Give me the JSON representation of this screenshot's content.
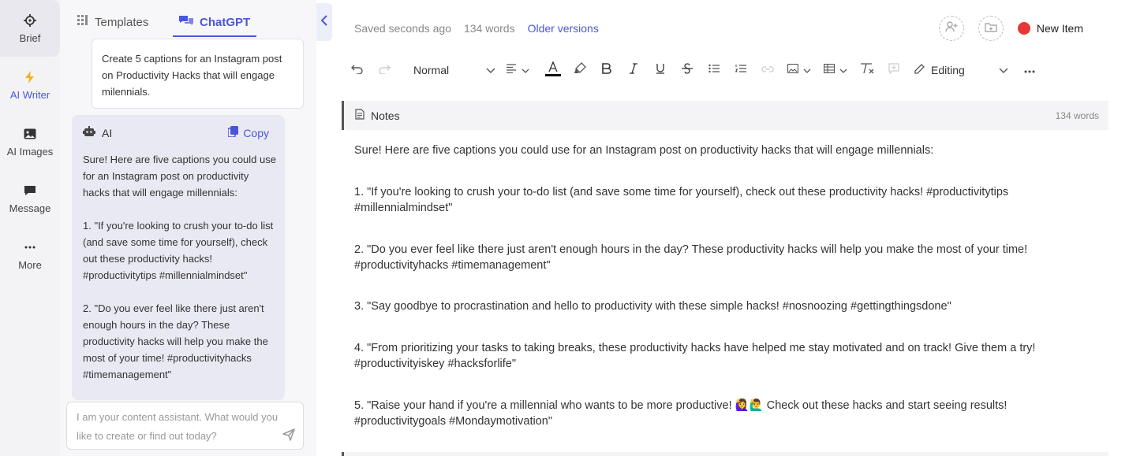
{
  "rail": {
    "items": [
      {
        "label": "Brief",
        "icon": "crosshair-icon"
      },
      {
        "label": "AI Writer",
        "icon": "lightning-icon"
      },
      {
        "label": "AI Images",
        "icon": "image-icon"
      },
      {
        "label": "Message",
        "icon": "chat-icon"
      },
      {
        "label": "More",
        "icon": "ellipsis-icon"
      }
    ]
  },
  "panel": {
    "tabs": [
      {
        "label": "Templates",
        "icon": "grid-icon"
      },
      {
        "label": "ChatGPT",
        "icon": "chat-bubbles-icon"
      }
    ],
    "prompt": "Create 5 captions for an Instagram post on Productivity Hacks that will engage milennials.",
    "ai": {
      "sender": "AI",
      "copy_label": "Copy",
      "paragraphs": [
        "Sure! Here are five captions you could use for an Instagram post on productivity hacks that will engage millennials:",
        "1. \"If you're looking to crush your to-do list (and save some time for yourself), check out these productivity hacks! #productivitytips #millennialmindset\"",
        "2. \"Do you ever feel like there just aren't enough hours in the day? These productivity hacks will help you make the most of your time! #productivityhacks #timemanagement\""
      ]
    },
    "input_placeholder": "I am your content assistant. What would you like to create or find out today?"
  },
  "editor": {
    "status": {
      "saved": "Saved seconds ago",
      "words": "134 words",
      "versions_link": "Older versions"
    },
    "new_item_label": "New Item",
    "toolbar": {
      "style_select": "Normal",
      "mode_select": "Editing"
    },
    "notes": {
      "title": "Notes",
      "count": "134 words"
    },
    "doc": {
      "paragraphs": [
        "Sure! Here are five captions you could use for an Instagram post on productivity hacks that will engage millennials:",
        "1. \"If you're looking to crush your to-do list (and save some time for yourself), check out these productivity hacks! #productivitytips #millennialmindset\"",
        "2. \"Do you ever feel like there just aren't enough hours in the day? These productivity hacks will help you make the most of your time! #productivityhacks #timemanagement\"",
        "3. \"Say goodbye to procrastination and hello to productivity with these simple hacks! #nosnoozing #gettingthingsdone\"",
        "4. \"From prioritizing your tasks to taking breaks, these productivity hacks have helped me stay motivated and on track! Give them a try! #productivityiskey #hacksforlife\"",
        "5. \"Raise your hand if you're a millennial who wants to be more productive! 🙋‍♀️🙋‍♂️ Check out these hacks and start seeing results! #productivitygoals #Mondaymotivation\""
      ]
    }
  },
  "colors": {
    "accent": "#4a56d8",
    "new_item_dot": "#e53935"
  }
}
